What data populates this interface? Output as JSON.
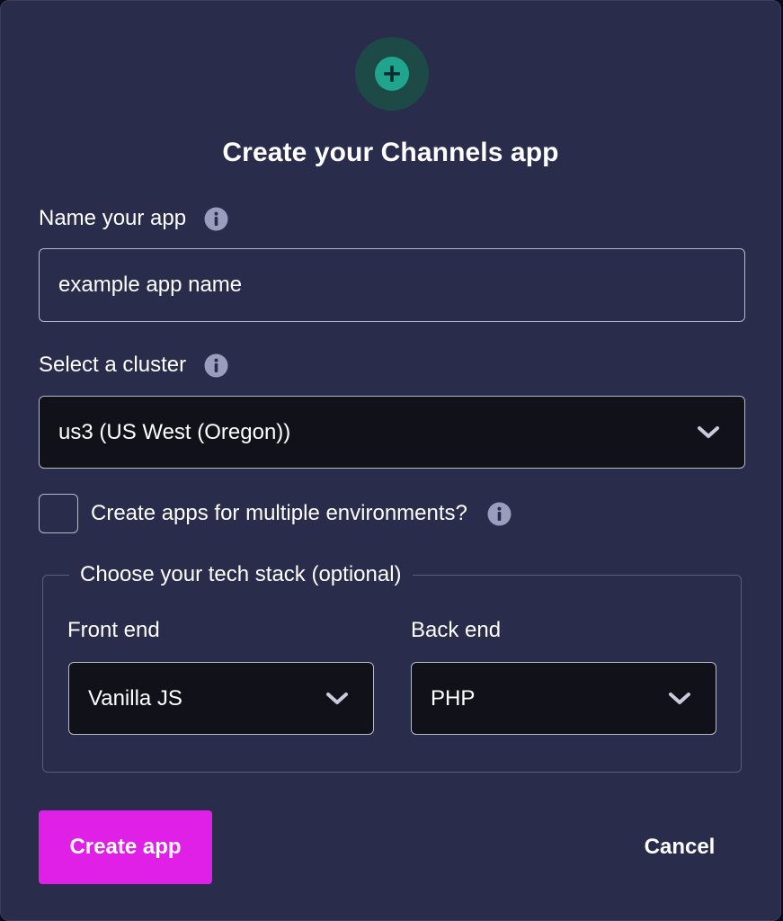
{
  "dialog": {
    "title": "Create your Channels app",
    "header_icon": "plus-circle-icon"
  },
  "name_field": {
    "label": "Name your app",
    "placeholder": "example app name",
    "value": ""
  },
  "cluster_field": {
    "label": "Select a cluster",
    "selected": "us3 (US West (Oregon))"
  },
  "multi_env": {
    "label": "Create apps for multiple environments?",
    "checked": false
  },
  "tech_stack": {
    "legend": "Choose your tech stack (optional)",
    "front_end": {
      "label": "Front end",
      "selected": "Vanilla JS"
    },
    "back_end": {
      "label": "Back end",
      "selected": "PHP"
    }
  },
  "actions": {
    "create_label": "Create app",
    "cancel_label": "Cancel"
  },
  "colors": {
    "background": "#292c4a",
    "accent": "#e020e6",
    "icon_teal": "#1fa58d",
    "info_icon": "#9a9dbd"
  }
}
